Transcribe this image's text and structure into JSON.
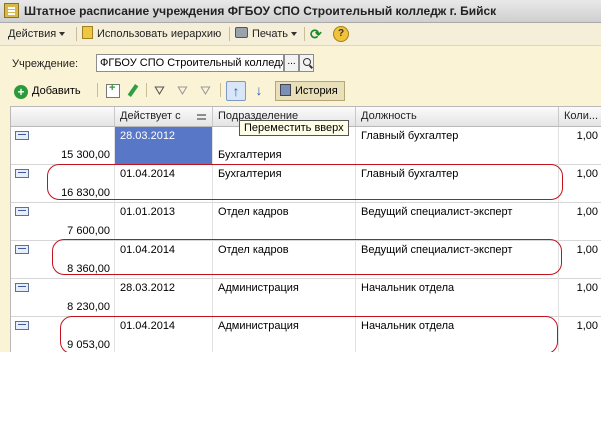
{
  "window": {
    "title": "Штатное расписание учреждения ФГБОУ СПО Строительный колледж г. Бийск"
  },
  "toolbar": {
    "actions_label": "Действия",
    "hierarchy_label": "Использовать иерархию",
    "print_label": "Печать",
    "refresh_icon": "refresh-icon",
    "help_label": "?"
  },
  "institution": {
    "label": "Учреждение:",
    "value": "ФГБОУ СПО Строительный колледж",
    "select_label": "..."
  },
  "list_toolbar": {
    "add_label": "Добавить",
    "move_up_label": "↑",
    "move_down_label": "↓",
    "history_label": "История",
    "tooltip": "Переместить вверх"
  },
  "table": {
    "columns": [
      "Действует с",
      "Подразделение",
      "Должность",
      "Коли..."
    ],
    "rows": [
      {
        "date": "28.03.2012",
        "department": "Бухгалтерия",
        "position": "Главный бухгалтер",
        "qty": "1,00",
        "salary": "15 300,00",
        "selected": true
      },
      {
        "date": "01.04.2014",
        "department": "Бухгалтерия",
        "position": "Главный бухгалтер",
        "qty": "1,00",
        "salary": "16 830,00",
        "selected": false
      },
      {
        "date": "01.01.2013",
        "department": "Отдел кадров",
        "position": "Ведущий специалист-эксперт",
        "qty": "1,00",
        "salary": "7 600,00",
        "selected": false
      },
      {
        "date": "01.04.2014",
        "department": "Отдел кадров",
        "position": "Ведущий специалист-эксперт",
        "qty": "1,00",
        "salary": "8 360,00",
        "selected": false
      },
      {
        "date": "28.03.2012",
        "department": "Администрация",
        "position": "Начальник отдела",
        "qty": "1,00",
        "salary": "8 230,00",
        "selected": false
      },
      {
        "date": "01.04.2014",
        "department": "Администрация",
        "position": "Начальник отдела",
        "qty": "1,00",
        "salary": "9 053,00",
        "selected": false
      }
    ]
  },
  "colors": {
    "selection": "#5877c7",
    "highlight_oval": "#c3111e",
    "window_background": "#fbf3d6"
  }
}
